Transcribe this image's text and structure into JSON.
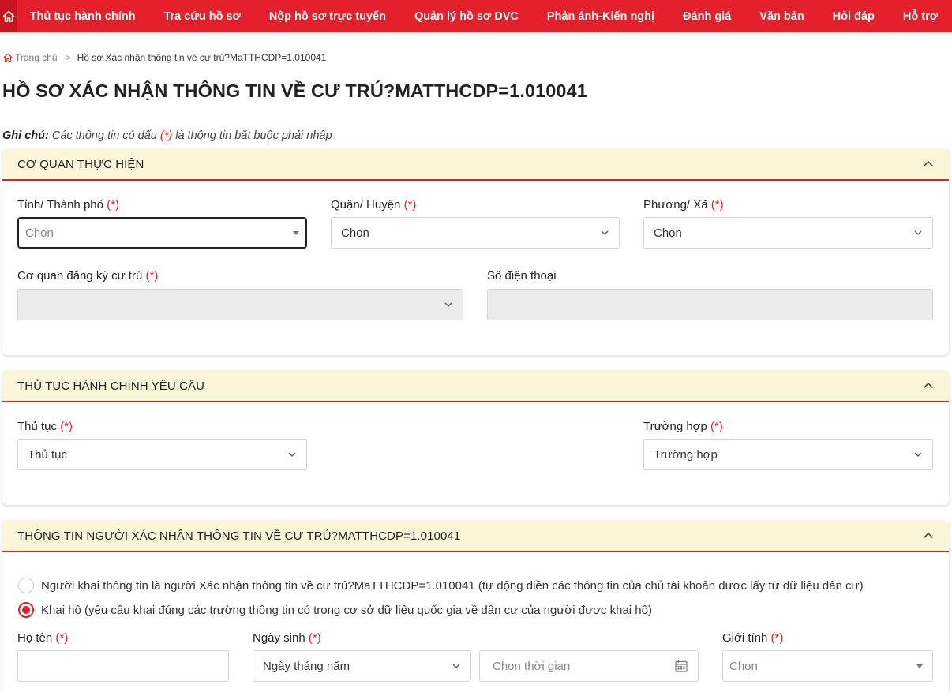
{
  "nav": {
    "items": [
      "Thủ tục hành chính",
      "Tra cứu hồ sơ",
      "Nộp hồ sơ trực tuyến",
      "Quản lý hồ sơ DVC",
      "Phản ánh-Kiến nghị",
      "Đánh giá",
      "Văn bản",
      "Hỏi đáp",
      "Hỗ trợ"
    ]
  },
  "breadcrumb": {
    "home": "Trang chủ",
    "current": "Hồ sơ Xác nhận thông tin về cư trú?MaTTHCDP=1.010041"
  },
  "page_title": "HỒ SƠ XÁC NHẬN THÔNG TIN VỀ CƯ TRÚ?MATTHCDP=1.010041",
  "note": {
    "label": "Ghi chú:",
    "text_before": " Các thông tin có dấu ",
    "required_mark": "(*)",
    "text_after": " là thông tin bắt buộc phải nhập"
  },
  "required_mark": "(*)",
  "section1": {
    "title": "CƠ QUAN THỰC HIỆN",
    "province_label": "Tỉnh/ Thành phố",
    "province_value": "Chọn",
    "district_label": "Quận/ Huyện",
    "district_value": "Chọn",
    "ward_label": "Phường/ Xã",
    "ward_value": "Chọn",
    "agency_label": "Cơ quan đăng ký cư trú",
    "agency_value": "",
    "phone_label": "Số điện thoại",
    "phone_value": ""
  },
  "section2": {
    "title": "THỦ TỤC HÀNH CHÍNH YÊU CẦU",
    "procedure_label": "Thủ tục",
    "procedure_value": "Thủ tục",
    "case_label": "Trường hợp",
    "case_value": "Trường hợp"
  },
  "section3": {
    "title": "THÔNG TIN NGƯỜI XÁC NHẬN THÔNG TIN VỀ CƯ TRÚ?MATTHCDP=1.010041",
    "radio_self": "Người khai thông tin là người Xác nhận thông tin về cư trú?MaTTHCDP=1.010041 (tự động điền các thông tin của chủ tài khoản được lấy từ dữ liệu dân cư)",
    "radio_proxy": "Khai hộ (yêu cầu khai đúng các trường thông tin có trong cơ sở dữ liệu quốc gia về dân cư của người được khai hộ)",
    "name_label": "Họ tên",
    "name_value": "",
    "dob_label": "Ngày sinh",
    "dob_format_value": "Ngày tháng năm",
    "dob_date_placeholder": "Chọn thời gian",
    "gender_label": "Giới tính",
    "gender_value": "Chọn"
  },
  "colors": {
    "brand_red": "#e3202b",
    "panel_header_bg": "#fdf5d8"
  }
}
